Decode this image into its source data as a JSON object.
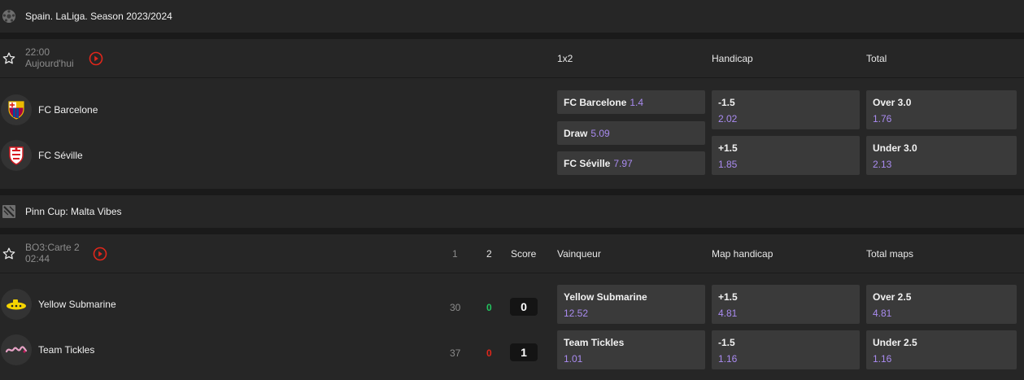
{
  "colors": {
    "accent_odds": "#a98bf0",
    "live_red": "#e0261b",
    "won_green": "#22c35e",
    "lost_red": "#e0261b"
  },
  "match1": {
    "league": "Spain. LaLiga. Season 2023/2024",
    "league_icon": "soccer-ball-icon",
    "time": "22:00",
    "day": "Aujourd'hui",
    "col_1x2": "1x2",
    "col_handicap": "Handicap",
    "col_total": "Total",
    "team1": {
      "name": "FC Barcelone",
      "logo": "fc-barcelona-crest-icon"
    },
    "team2": {
      "name": "FC Séville",
      "logo": "sevilla-fc-crest-icon"
    },
    "odds_1x2": [
      {
        "label": "FC Barcelone",
        "odd": "1.4"
      },
      {
        "label": "Draw",
        "odd": "5.09"
      },
      {
        "label": "FC Séville",
        "odd": "7.97"
      }
    ],
    "handicap": [
      {
        "label": "-1.5",
        "odd": "2.02"
      },
      {
        "label": "+1.5",
        "odd": "1.85"
      }
    ],
    "total": [
      {
        "label": "Over 3.0",
        "odd": "1.76"
      },
      {
        "label": "Under 3.0",
        "odd": "2.13"
      }
    ]
  },
  "match2": {
    "league": "Pinn Cup: Malta Vibes",
    "league_icon": "dota-icon",
    "time": "BO3:Carte 2",
    "day": "02:44",
    "col_g1": "1",
    "col_g2": "2",
    "col_score": "Score",
    "col_winner": "Vainqueur",
    "col_maphandicap": "Map handicap",
    "col_totalmaps": "Total maps",
    "team1": {
      "name": "Yellow Submarine",
      "logo": "yellow-submarine-logo-icon",
      "g1": "30",
      "g2": "0",
      "score": "0"
    },
    "team2": {
      "name": "Team Tickles",
      "logo": "team-tickles-logo-icon",
      "g1": "37",
      "g2": "0",
      "score": "1"
    },
    "winner": [
      {
        "label": "Yellow Submarine",
        "odd": "12.52"
      },
      {
        "label": "Team Tickles",
        "odd": "1.01"
      }
    ],
    "map_handicap": [
      {
        "label": "+1.5",
        "odd": "4.81"
      },
      {
        "label": "-1.5",
        "odd": "1.16"
      }
    ],
    "total_maps": [
      {
        "label": "Over 2.5",
        "odd": "4.81"
      },
      {
        "label": "Under 2.5",
        "odd": "1.16"
      }
    ]
  }
}
